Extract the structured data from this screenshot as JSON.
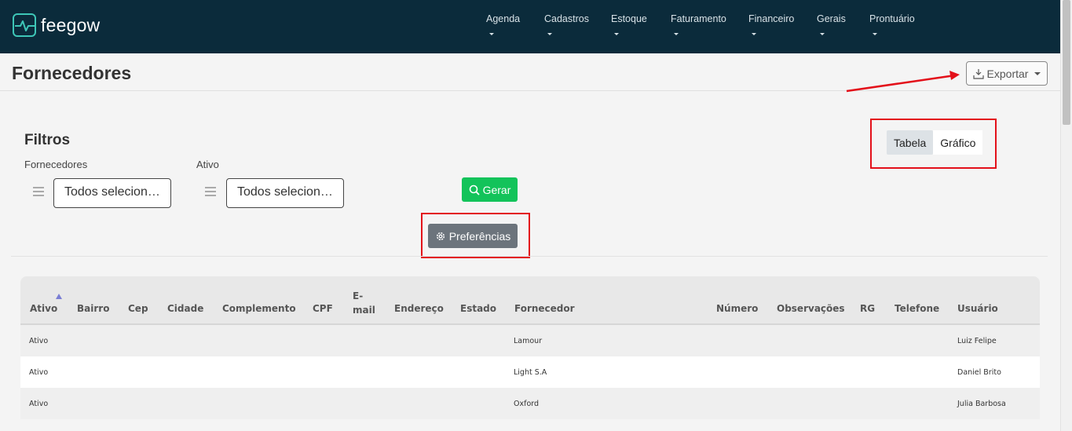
{
  "brand": {
    "name": "feegow",
    "accent": "#3ec6b7",
    "topbar_bg": "#0b2b3b"
  },
  "nav": [
    "Agenda",
    "Cadastros",
    "Estoque",
    "Faturamento",
    "Financeiro",
    "Gerais",
    "Prontuário"
  ],
  "page": {
    "title": "Fornecedores"
  },
  "export": {
    "label": "Exportar",
    "icon": "download-icon"
  },
  "view_toggle": {
    "active": "Tabela",
    "inactive": "Gráfico"
  },
  "filters": {
    "heading": "Filtros",
    "fornecedores": {
      "label": "Fornecedores",
      "value": "Todos selecionados"
    },
    "ativo": {
      "label": "Ativo",
      "value": "Todos selecionados"
    }
  },
  "buttons": {
    "gerar": "Gerar",
    "preferencias": "Preferências",
    "gerar_color": "#13c35a"
  },
  "table": {
    "columns": [
      "Ativo",
      "Bairro",
      "Cep",
      "Cidade",
      "Complemento",
      "CPF",
      "E-mail",
      "Endereço",
      "Estado",
      "Fornecedor",
      "Número",
      "Observações",
      "RG",
      "Telefone",
      "Usuário"
    ],
    "email_parts": [
      "E-",
      "mail"
    ],
    "sorted_by": "Ativo",
    "rows": [
      {
        "ativo": "Ativo",
        "fornecedor": "Lamour",
        "usuario": "Luiz Felipe"
      },
      {
        "ativo": "Ativo",
        "fornecedor": "Light S.A",
        "usuario": "Daniel Brito"
      },
      {
        "ativo": "Ativo",
        "fornecedor": "Oxford",
        "usuario": "Julia Barbosa"
      }
    ]
  },
  "highlight_color": "#e3101a"
}
